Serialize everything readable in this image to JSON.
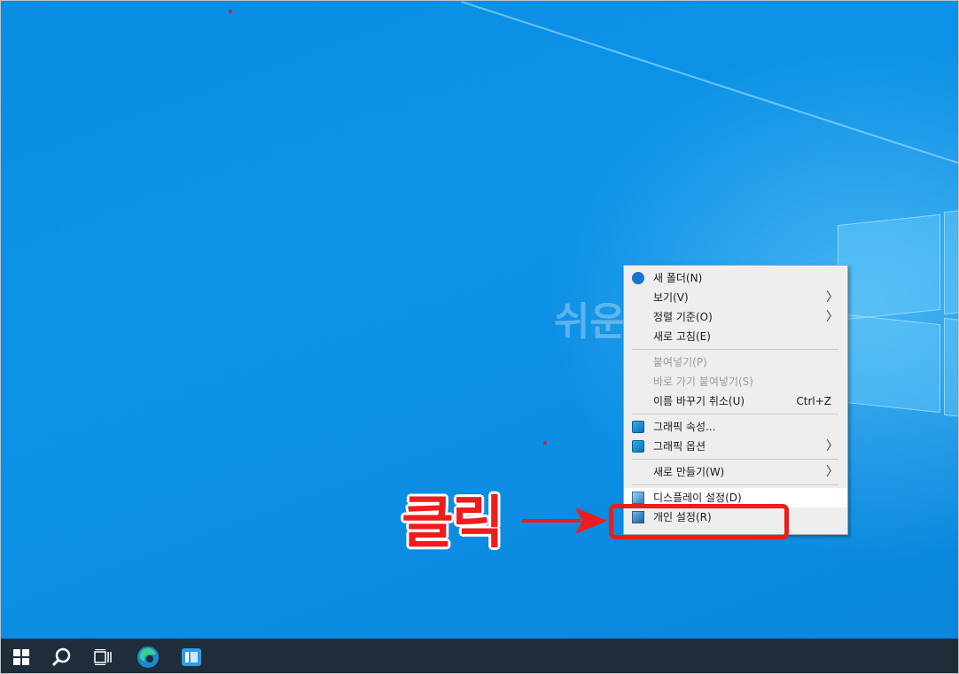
{
  "colors": {
    "desktop": "#0b92e6",
    "taskbar": "#1f2d3a",
    "annotation": "#ee1c1c"
  },
  "watermark": "쉬운",
  "context_menu": {
    "items": [
      {
        "label": "새 폴더(N)",
        "icon": "new-folder-icon",
        "disabled": false,
        "submenu": false
      },
      {
        "label": "보기(V)",
        "disabled": false,
        "submenu": true
      },
      {
        "label": "정렬 기준(O)",
        "disabled": false,
        "submenu": true
      },
      {
        "label": "새로 고침(E)",
        "disabled": false,
        "submenu": false
      },
      {
        "label": "붙여넣기(P)",
        "disabled": true,
        "submenu": false
      },
      {
        "label": "바로 가기 붙여넣기(S)",
        "disabled": true,
        "submenu": false
      },
      {
        "label": "이름 바꾸기 취소(U)",
        "shortcut": "Ctrl+Z",
        "disabled": false,
        "submenu": false
      },
      {
        "label": "그래픽 속성...",
        "icon": "graphics-icon",
        "disabled": false,
        "submenu": false
      },
      {
        "label": "그래픽 옵션",
        "icon": "graphics-icon",
        "disabled": false,
        "submenu": true
      },
      {
        "label": "새로 만들기(W)",
        "disabled": false,
        "submenu": true
      },
      {
        "label": "디스플레이 설정(D)",
        "icon": "display-settings-icon",
        "disabled": false,
        "submenu": false
      },
      {
        "label": "개인 설정(R)",
        "icon": "personalize-icon",
        "disabled": false,
        "submenu": false
      }
    ]
  },
  "annotation": {
    "label": "클릭",
    "arrow_icon": "red-arrow-icon"
  },
  "taskbar": {
    "buttons": [
      {
        "name": "start-button",
        "icon": "windows-logo-icon"
      },
      {
        "name": "search-button",
        "icon": "search-icon"
      },
      {
        "name": "task-view-button",
        "icon": "task-view-icon"
      },
      {
        "name": "edge-button",
        "icon": "edge-icon"
      },
      {
        "name": "app-button",
        "icon": "app-icon"
      }
    ]
  }
}
